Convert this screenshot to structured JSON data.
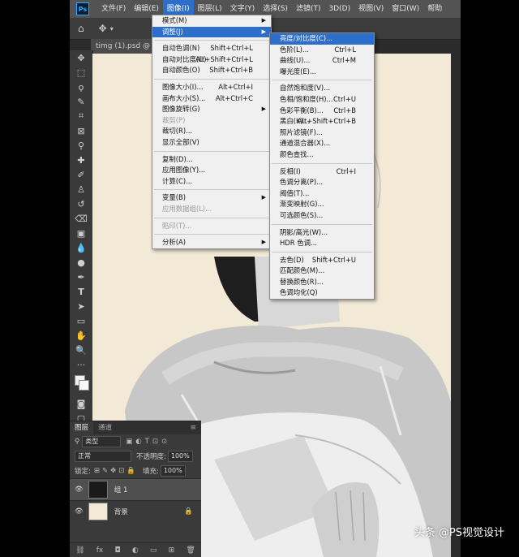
{
  "menubar": {
    "logo": "Ps",
    "items": [
      "文件(F)",
      "编辑(E)",
      "图像(I)",
      "图层(L)",
      "文字(Y)",
      "选择(S)",
      "滤镜(T)",
      "3D(D)",
      "视图(V)",
      "窗口(W)",
      "帮助"
    ]
  },
  "doc_tab": "timg (1).psd @ 90",
  "image_menu": {
    "items": [
      {
        "label": "模式(M)",
        "shortcut": "",
        "arrow": true
      },
      {
        "label": "调整(J)",
        "shortcut": "",
        "arrow": true,
        "highlight": true
      },
      {
        "sep": true
      },
      {
        "label": "自动色调(N)",
        "shortcut": "Shift+Ctrl+L"
      },
      {
        "label": "自动对比度(U)",
        "shortcut": "Alt+Shift+Ctrl+L"
      },
      {
        "label": "自动颜色(O)",
        "shortcut": "Shift+Ctrl+B"
      },
      {
        "sep": true
      },
      {
        "label": "图像大小(I)...",
        "shortcut": "Alt+Ctrl+I"
      },
      {
        "label": "画布大小(S)...",
        "shortcut": "Alt+Ctrl+C"
      },
      {
        "label": "图像旋转(G)",
        "shortcut": "",
        "arrow": true
      },
      {
        "label": "裁剪(P)",
        "shortcut": "",
        "disabled": true
      },
      {
        "label": "裁切(R)...",
        "shortcut": ""
      },
      {
        "label": "显示全部(V)",
        "shortcut": ""
      },
      {
        "sep": true
      },
      {
        "label": "复制(D)...",
        "shortcut": ""
      },
      {
        "label": "应用图像(Y)...",
        "shortcut": ""
      },
      {
        "label": "计算(C)...",
        "shortcut": ""
      },
      {
        "sep": true
      },
      {
        "label": "变量(B)",
        "shortcut": "",
        "arrow": true
      },
      {
        "label": "应用数据组(L)...",
        "shortcut": "",
        "disabled": true
      },
      {
        "sep": true
      },
      {
        "label": "陷印(T)...",
        "shortcut": "",
        "disabled": true
      },
      {
        "sep": true
      },
      {
        "label": "分析(A)",
        "shortcut": "",
        "arrow": true
      }
    ]
  },
  "adjust_menu": {
    "items": [
      {
        "label": "亮度/对比度(C)...",
        "shortcut": "",
        "highlight": true
      },
      {
        "label": "色阶(L)...",
        "shortcut": "Ctrl+L"
      },
      {
        "label": "曲线(U)...",
        "shortcut": "Ctrl+M"
      },
      {
        "label": "曝光度(E)...",
        "shortcut": ""
      },
      {
        "sep": true
      },
      {
        "label": "自然饱和度(V)...",
        "shortcut": ""
      },
      {
        "label": "色相/饱和度(H)...",
        "shortcut": "Ctrl+U"
      },
      {
        "label": "色彩平衡(B)...",
        "shortcut": "Ctrl+B"
      },
      {
        "label": "黑白(K)...",
        "shortcut": "Alt+Shift+Ctrl+B"
      },
      {
        "label": "照片滤镜(F)...",
        "shortcut": ""
      },
      {
        "label": "通道混合器(X)...",
        "shortcut": ""
      },
      {
        "label": "颜色查找...",
        "shortcut": ""
      },
      {
        "sep": true
      },
      {
        "label": "反相(I)",
        "shortcut": "Ctrl+I"
      },
      {
        "label": "色调分离(P)...",
        "shortcut": ""
      },
      {
        "label": "阈值(T)...",
        "shortcut": ""
      },
      {
        "label": "渐变映射(G)...",
        "shortcut": ""
      },
      {
        "label": "可选颜色(S)...",
        "shortcut": ""
      },
      {
        "sep": true
      },
      {
        "label": "阴影/高光(W)...",
        "shortcut": ""
      },
      {
        "label": "HDR 色调...",
        "shortcut": ""
      },
      {
        "sep": true
      },
      {
        "label": "去色(D)",
        "shortcut": "Shift+Ctrl+U"
      },
      {
        "label": "匹配颜色(M)...",
        "shortcut": ""
      },
      {
        "label": "替换颜色(R)...",
        "shortcut": ""
      },
      {
        "label": "色调均化(Q)",
        "shortcut": ""
      }
    ]
  },
  "layers_panel": {
    "tabs": [
      "图层",
      "通道"
    ],
    "filter_kind": "类型",
    "blend_mode": "正常",
    "opacity_label": "不透明度:",
    "opacity_value": "100%",
    "lock_label": "锁定:",
    "fill_label": "填充:",
    "fill_value": "100%",
    "layers": [
      {
        "name": "组 1",
        "selected": true
      },
      {
        "name": "背景",
        "selected": false
      }
    ]
  },
  "watermark": "头条 @PS视觉设计",
  "colors": {
    "accent": "#2d6ecb",
    "canvas_bg": "#f2ead7"
  }
}
